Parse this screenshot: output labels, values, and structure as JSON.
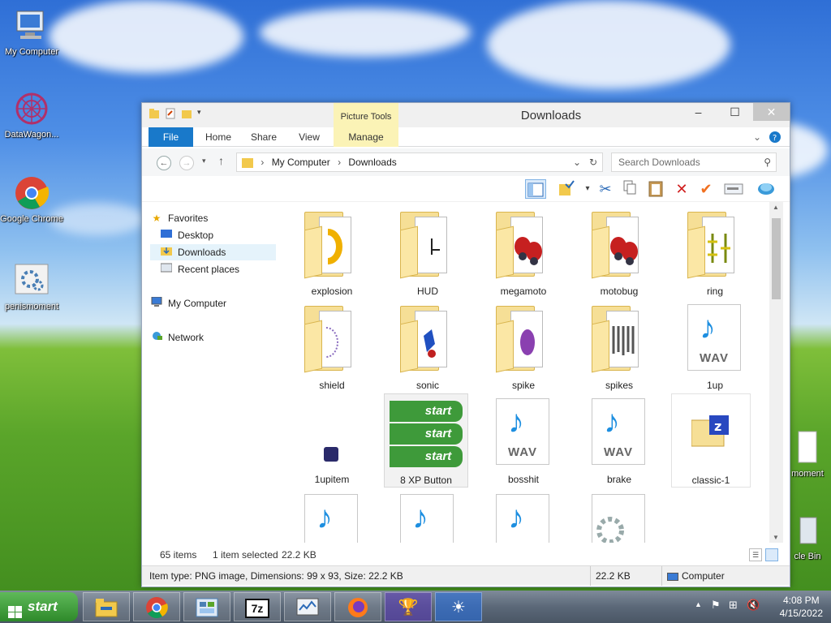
{
  "desktop": {
    "icons": [
      {
        "label": "My Computer"
      },
      {
        "label": "DataWagon..."
      },
      {
        "label": "Google Chrome"
      },
      {
        "label": "penismoment"
      },
      {
        "label": "moment"
      },
      {
        "label": "cle Bin"
      }
    ]
  },
  "window": {
    "title": "Downloads",
    "picture_tools": "Picture Tools",
    "tabs": {
      "file": "File",
      "home": "Home",
      "share": "Share",
      "view": "View",
      "manage": "Manage"
    },
    "controls": {
      "minimize": "–",
      "maximize": "☐",
      "close": "✕"
    },
    "address": {
      "root": "My Computer",
      "current": "Downloads"
    },
    "search_placeholder": "Search Downloads",
    "nav": {
      "favorites": "Favorites",
      "desktop": "Desktop",
      "downloads": "Downloads",
      "recent": "Recent places",
      "computer": "My Computer",
      "network": "Network"
    },
    "items": [
      {
        "label": "explosion",
        "kind": "folder"
      },
      {
        "label": "HUD",
        "kind": "folder"
      },
      {
        "label": "megamoto",
        "kind": "folder"
      },
      {
        "label": "motobug",
        "kind": "folder"
      },
      {
        "label": "ring",
        "kind": "folder"
      },
      {
        "label": "shield",
        "kind": "folder"
      },
      {
        "label": "sonic",
        "kind": "folder"
      },
      {
        "label": "spike",
        "kind": "folder"
      },
      {
        "label": "spikes",
        "kind": "folder"
      },
      {
        "label": "1up",
        "kind": "wav"
      },
      {
        "label": "1upitem",
        "kind": "png"
      },
      {
        "label": "8 XP Button",
        "kind": "png"
      },
      {
        "label": "bosshit",
        "kind": "wav"
      },
      {
        "label": "brake",
        "kind": "wav"
      },
      {
        "label": "classic-1",
        "kind": "zip"
      }
    ],
    "wav_text": "WAV",
    "xp_button_text": "start",
    "status": {
      "count": "65 items",
      "selected": "1 item selected",
      "size": "22.2 KB"
    },
    "details": {
      "info": "Item type: PNG image, Dimensions: 99 x 93, Size: 22.2 KB",
      "size": "22.2 KB",
      "location": "Computer"
    }
  },
  "taskbar": {
    "start_label": "start",
    "clock_time": "4:08 PM",
    "clock_date": "4/15/2022",
    "apps": [
      "file-explorer-icon",
      "chrome-icon",
      "control-panel-icon",
      "7zip-icon",
      "task-manager-icon",
      "firefox-icon",
      "trophy-icon",
      "weather-icon"
    ],
    "sevenzip_label": "7z"
  },
  "colors": {
    "accent": "#1979ca",
    "picture_tools": "#fbf3b6",
    "taskbar": "#5b6878",
    "start": "#2e8a2a"
  }
}
